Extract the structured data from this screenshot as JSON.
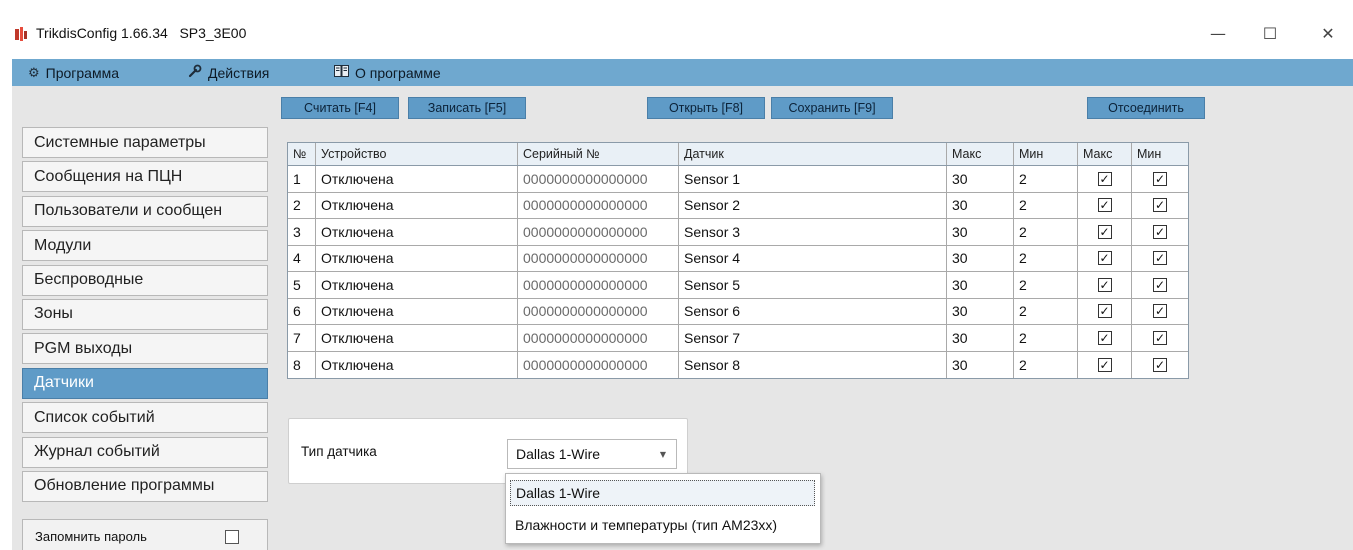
{
  "window": {
    "title": "TrikdisConfig 1.66.34   SP3_3E00",
    "icon": "trikdis-app-icon",
    "controls": {
      "minimize": "—",
      "maximize": "☐",
      "close": "✕"
    }
  },
  "menu": {
    "items": [
      {
        "label": "Программа",
        "icon": "gear-icon"
      },
      {
        "label": "Действия",
        "icon": "wrench-icon"
      },
      {
        "label": "О программе",
        "icon": "book-icon"
      }
    ]
  },
  "toolbar": {
    "read": "Считать [F4]",
    "write": "Записать [F5]",
    "open": "Открыть [F8]",
    "save": "Сохранить [F9]",
    "disconnect": "Отсоединить"
  },
  "sidebar": {
    "items": [
      {
        "label": "Системные параметры"
      },
      {
        "label": "Сообщения на ПЦН"
      },
      {
        "label": "Пользователи и сообщен"
      },
      {
        "label": "Модули"
      },
      {
        "label": "Беспроводные"
      },
      {
        "label": "Зоны"
      },
      {
        "label": "PGM выходы"
      },
      {
        "label": "Датчики"
      },
      {
        "label": "Список событий"
      },
      {
        "label": "Журнал событий"
      },
      {
        "label": "Обновление программы"
      }
    ],
    "active_index": 7,
    "remember_password": {
      "label": "Запомнить пароль",
      "checked": false
    }
  },
  "table": {
    "headers": [
      "№",
      "Устройство",
      "Серийный №",
      "Датчик",
      "Макс",
      "Мин",
      "Макс",
      "Мин"
    ],
    "rows": [
      {
        "num": "1",
        "device": "Отключена",
        "serial": "0000000000000000",
        "sensor": "Sensor 1",
        "max": "30",
        "min": "2",
        "alarm_max": true,
        "alarm_min": true
      },
      {
        "num": "2",
        "device": "Отключена",
        "serial": "0000000000000000",
        "sensor": "Sensor 2",
        "max": "30",
        "min": "2",
        "alarm_max": true,
        "alarm_min": true
      },
      {
        "num": "3",
        "device": "Отключена",
        "serial": "0000000000000000",
        "sensor": "Sensor 3",
        "max": "30",
        "min": "2",
        "alarm_max": true,
        "alarm_min": true
      },
      {
        "num": "4",
        "device": "Отключена",
        "serial": "0000000000000000",
        "sensor": "Sensor 4",
        "max": "30",
        "min": "2",
        "alarm_max": true,
        "alarm_min": true
      },
      {
        "num": "5",
        "device": "Отключена",
        "serial": "0000000000000000",
        "sensor": "Sensor 5",
        "max": "30",
        "min": "2",
        "alarm_max": true,
        "alarm_min": true
      },
      {
        "num": "6",
        "device": "Отключена",
        "serial": "0000000000000000",
        "sensor": "Sensor 6",
        "max": "30",
        "min": "2",
        "alarm_max": true,
        "alarm_min": true
      },
      {
        "num": "7",
        "device": "Отключена",
        "serial": "0000000000000000",
        "sensor": "Sensor 7",
        "max": "30",
        "min": "2",
        "alarm_max": true,
        "alarm_min": true
      },
      {
        "num": "8",
        "device": "Отключена",
        "serial": "0000000000000000",
        "sensor": "Sensor 8",
        "max": "30",
        "min": "2",
        "alarm_max": true,
        "alarm_min": true
      }
    ]
  },
  "sensor_type": {
    "label": "Тип датчика",
    "selected": "Dallas 1-Wire",
    "options": [
      "Dallas 1-Wire",
      "Влажности и температуры (тип AM23xx)"
    ]
  },
  "colors": {
    "menubar": "#6fa8cf",
    "button": "#5f9bc7",
    "active_item": "#5f9bc7",
    "content_bg": "#e6e6e6"
  }
}
